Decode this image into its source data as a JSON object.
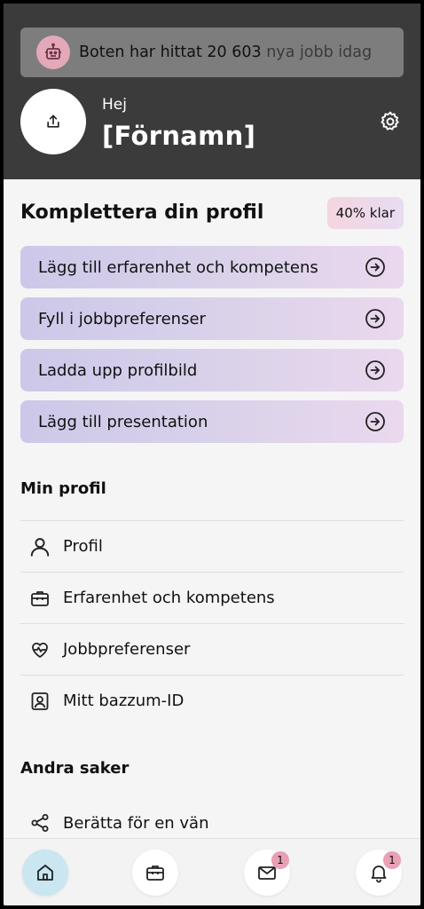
{
  "header": {
    "bot_banner": {
      "text_main": "Boten har hittat 20 603",
      "text_muted": "nya jobb idag",
      "icon": "robot-icon"
    },
    "greeting": "Hej",
    "name": "[Förnamn]",
    "upload_icon": "upload-icon",
    "settings_icon": "gear-icon"
  },
  "profile_completion": {
    "title": "Komplettera din profil",
    "progress_label": "40% klar",
    "progress": 0.4,
    "tasks": [
      {
        "label": "Lägg till erfarenhet och kompetens",
        "icon": "arrow-right-circle-icon"
      },
      {
        "label": "Fyll i jobbpreferenser",
        "icon": "arrow-right-circle-icon"
      },
      {
        "label": "Ladda upp profilbild",
        "icon": "arrow-right-circle-icon"
      },
      {
        "label": "Lägg till presentation",
        "icon": "arrow-right-circle-icon"
      }
    ]
  },
  "my_profile": {
    "heading": "Min profil",
    "items": [
      {
        "label": "Profil",
        "icon": "user-icon"
      },
      {
        "label": "Erfarenhet och kompetens",
        "icon": "briefcase-icon"
      },
      {
        "label": "Jobbpreferenser",
        "icon": "heart-pulse-icon"
      },
      {
        "label": "Mitt bazzum-ID",
        "icon": "id-card-icon"
      }
    ]
  },
  "other": {
    "heading": "Andra saker",
    "items": [
      {
        "label": "Berätta för en vän",
        "icon": "share-icon"
      }
    ]
  },
  "bottom_nav": {
    "items": [
      {
        "name": "home",
        "icon": "home-icon",
        "active": true
      },
      {
        "name": "jobs",
        "icon": "briefcase-icon",
        "active": false
      },
      {
        "name": "messages",
        "icon": "mail-icon",
        "badge": "1"
      },
      {
        "name": "notifications",
        "icon": "bell-icon",
        "badge": "1"
      }
    ]
  },
  "colors": {
    "header_bg": "#3b3b3b",
    "banner_bg": "#7d7d7d",
    "bot_icon_bg": "#e3a9b9",
    "task_gradient_start": "#ccc8e9",
    "task_gradient_end": "#ead8ee",
    "active_nav_bg": "#c9e6f1",
    "badge_bg": "#e8a0b5"
  }
}
